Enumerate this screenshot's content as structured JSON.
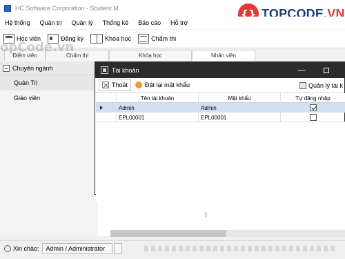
{
  "app": {
    "title": "HC Software Corporation - Student M"
  },
  "watermarks": {
    "logo_badge": "{}",
    "logo_text_main": "TOPCODE",
    "logo_text_tld": ".VN",
    "left_text": "opCode.vn"
  },
  "menu": [
    "Hệ thống",
    "Quản trị",
    "Quản lý",
    "Thống kê",
    "Báo cáo",
    "Hỗ trợ"
  ],
  "toolbar": [
    {
      "label": "Học viên",
      "icon": "graduation-cap-icon"
    },
    {
      "label": "Đăng ký",
      "icon": "id-card-icon"
    },
    {
      "label": "Khóa học",
      "icon": "book-icon"
    },
    {
      "label": "Chấm thi",
      "icon": "checklist-icon"
    }
  ],
  "tabs": [
    "Điểm viên",
    "Chấm thi",
    "Khóa học",
    "Nhân viên"
  ],
  "sidebar": {
    "header": "Chuyên ngành",
    "items": [
      {
        "label": "Quản Trị",
        "selected": true
      },
      {
        "label": "Giáo viên",
        "selected": false
      }
    ]
  },
  "status": {
    "greeting": "Xin chào:",
    "user": "Admin / Administrator"
  },
  "dialog": {
    "title": "Tài khoản",
    "minimize": "—",
    "buttons": {
      "exit": "Thoát",
      "reset_password": "Đặt lại mật khẩu",
      "manage_accounts": "Quản lý tài k"
    },
    "columns": [
      "Tên tài khoản",
      "Mật khẩu",
      "Tự đăng nhập"
    ],
    "rows": [
      {
        "username": "Admin",
        "password": "Admin",
        "auto_login": true,
        "current": true
      },
      {
        "username": "EPL00001",
        "password": "EPL00001",
        "auto_login": false,
        "current": false
      }
    ]
  },
  "colors": {
    "dialog_titlebar": "#2b2b2b",
    "selected_row": "#cfe0f4",
    "brand_blue": "#1f3d7a",
    "brand_red": "#e53935"
  }
}
